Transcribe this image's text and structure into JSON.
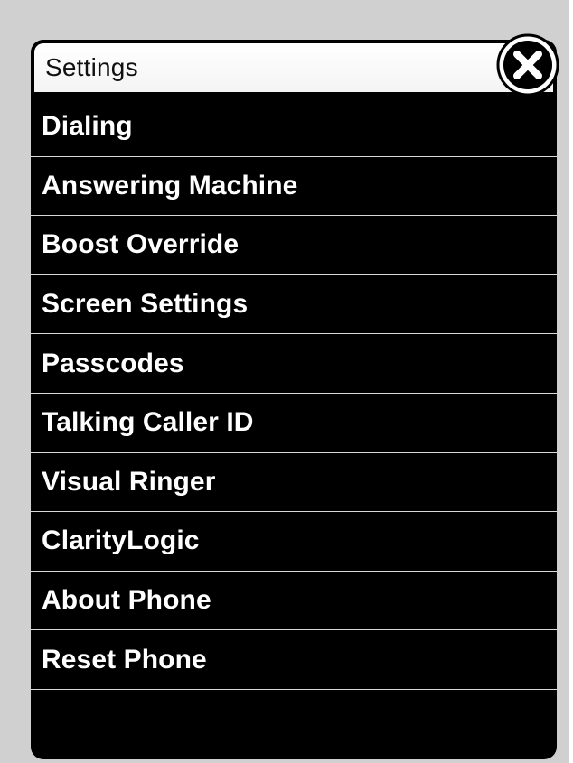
{
  "dialog": {
    "title": "Settings"
  },
  "menu": {
    "items": [
      {
        "label": "Dialing"
      },
      {
        "label": "Answering Machine"
      },
      {
        "label": "Boost Override"
      },
      {
        "label": "Screen Settings"
      },
      {
        "label": "Passcodes"
      },
      {
        "label": "Talking Caller ID"
      },
      {
        "label": "Visual Ringer"
      },
      {
        "label": "ClarityLogic"
      },
      {
        "label": "About Phone"
      },
      {
        "label": "Reset Phone"
      }
    ]
  },
  "icons": {
    "close": "close-icon"
  },
  "colors": {
    "panel_background": "#000000",
    "backdrop": "#d0d0d0",
    "title_bar": "#ffffff",
    "divider": "#d8d8d8",
    "item_text": "#ffffff"
  }
}
